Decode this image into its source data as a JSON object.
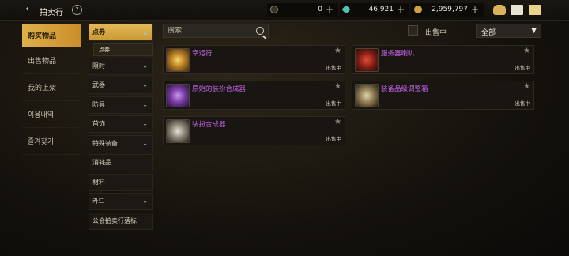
{
  "header": {
    "title": "拍卖行",
    "help": "?",
    "back": "‹"
  },
  "currency": [
    {
      "name": "coin-currency",
      "value": "0"
    },
    {
      "name": "gem-currency",
      "value": "46,921"
    },
    {
      "name": "gold-currency",
      "value": "2,959,797"
    }
  ],
  "plus": "+",
  "leftnav": [
    "购买物品",
    "出售物品",
    "我的上架",
    "이용내역",
    "즐겨찾기"
  ],
  "categories": [
    {
      "label": "点券",
      "chev": "▲"
    },
    {
      "label": "点券"
    },
    {
      "label": "限时",
      "chev": "⌄"
    },
    {
      "label": "武器",
      "chev": "⌄"
    },
    {
      "label": "防具",
      "chev": "⌄"
    },
    {
      "label": "首饰",
      "chev": "⌄"
    },
    {
      "label": "特殊装备",
      "chev": "⌄"
    },
    {
      "label": "消耗品"
    },
    {
      "label": "材料"
    },
    {
      "label": "카드",
      "chev": "⌄"
    },
    {
      "label": "公会拍卖行落标"
    }
  ],
  "search": {
    "placeholder": "搜索"
  },
  "filter": {
    "onsale_label": "出售中",
    "dropdown_value": "全部",
    "dropdown_arrow": "▼"
  },
  "items": [
    {
      "name": "幸运符",
      "status": "出售中",
      "star": "★"
    },
    {
      "name": "服务器喇叭",
      "status": "出售中",
      "star": "★"
    },
    {
      "name": "原始的装扮合成器",
      "status": "出售中",
      "star": "★"
    },
    {
      "name": "装备品级调整箱",
      "status": "出售中",
      "star": "★"
    },
    {
      "name": "装扮合成器",
      "status": "出售中",
      "star": "★"
    }
  ],
  "colors": {
    "accent": "#d9a840",
    "item_name": "#c061e4"
  }
}
